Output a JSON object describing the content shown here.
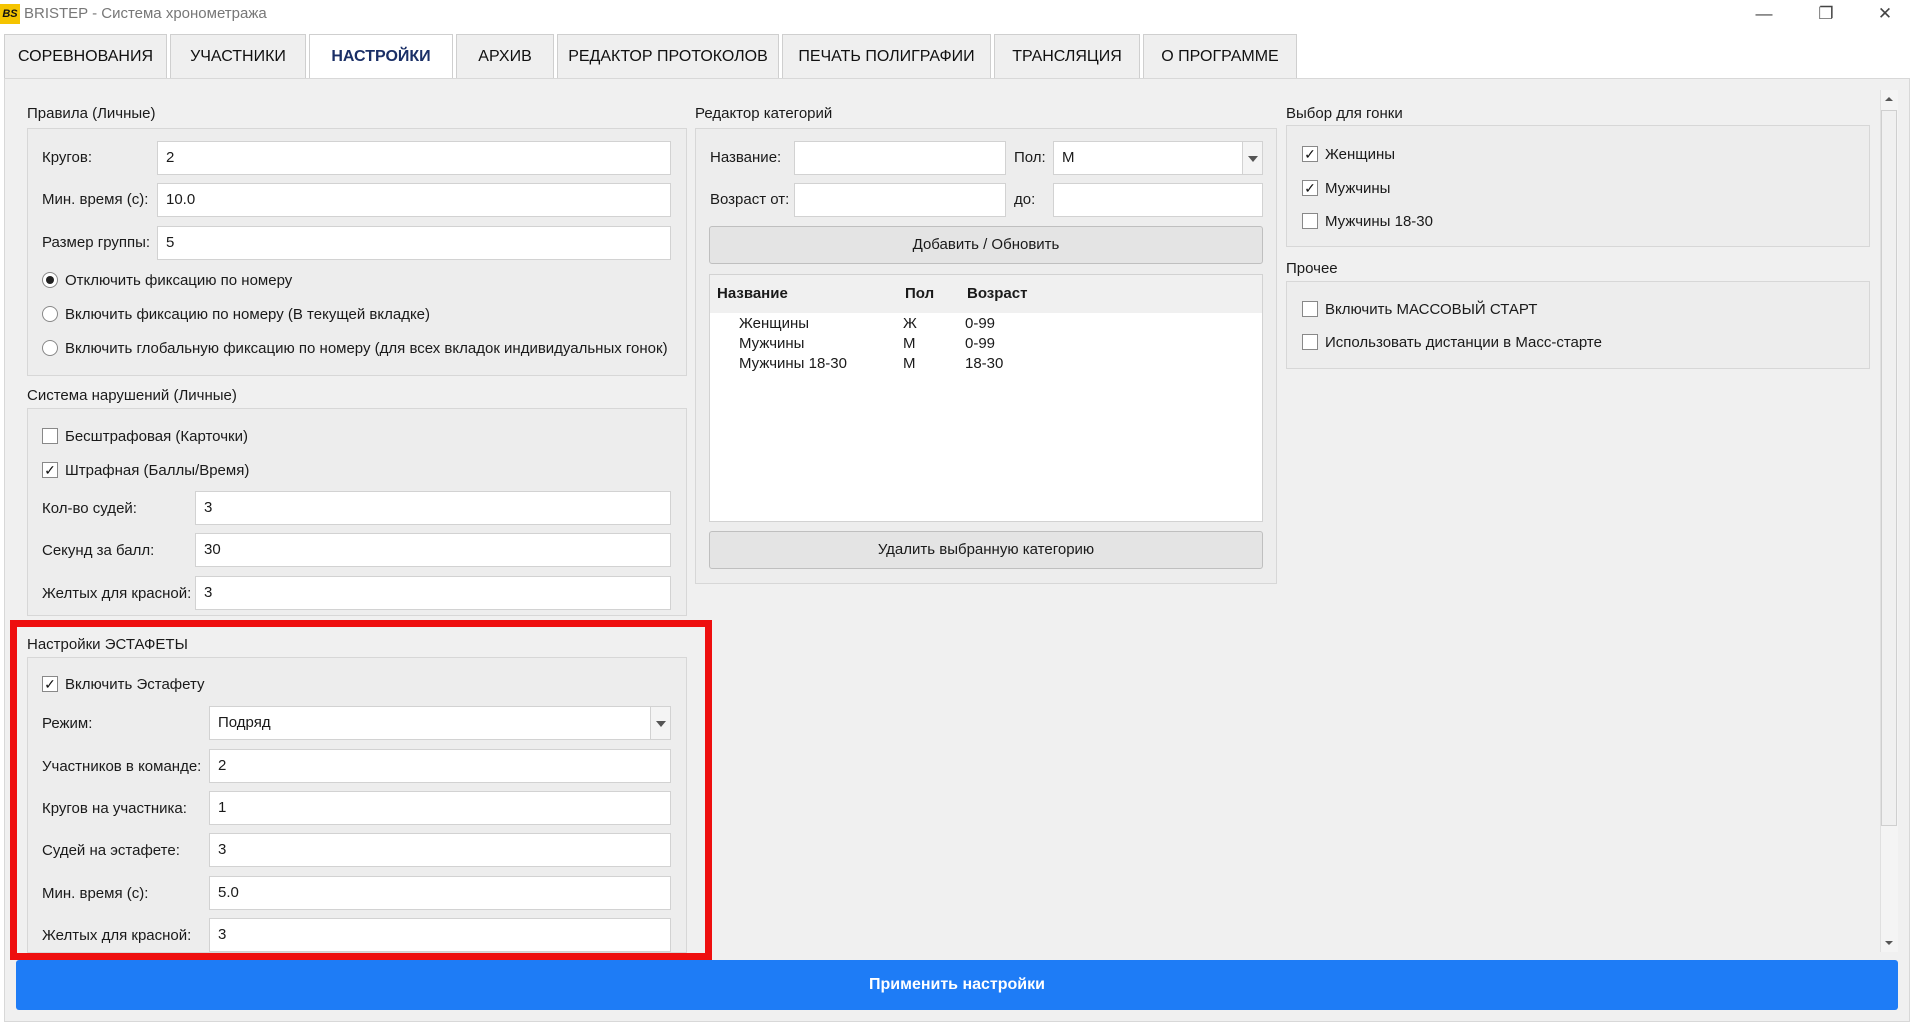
{
  "app": {
    "logo_text": "BS",
    "title": "BRISTEP - Система хронометража",
    "window_controls": {
      "minimize": "—",
      "restore": "❐",
      "close": "✕"
    }
  },
  "tabs": [
    {
      "label": "СОРЕВНОВАНИЯ",
      "active": false
    },
    {
      "label": "УЧАСТНИКИ",
      "active": false
    },
    {
      "label": "НАСТРОЙКИ",
      "active": true
    },
    {
      "label": "АРХИВ",
      "active": false
    },
    {
      "label": "РЕДАКТОР ПРОТОКОЛОВ",
      "active": false
    },
    {
      "label": "ПЕЧАТЬ ПОЛИГРАФИИ",
      "active": false
    },
    {
      "label": "ТРАНСЛЯЦИЯ",
      "active": false
    },
    {
      "label": "О ПРОГРАММЕ",
      "active": false
    }
  ],
  "rules": {
    "title": "Правила (Личные)",
    "laps_label": "Кругов:",
    "laps_value": "2",
    "min_time_label": "Мин. время (с):",
    "min_time_value": "10.0",
    "group_size_label": "Размер группы:",
    "group_size_value": "5",
    "radio_options": [
      {
        "label": "Отключить фиксацию по номеру",
        "selected": true
      },
      {
        "label": "Включить фиксацию по номеру (В текущей вкладке)",
        "selected": false
      },
      {
        "label": "Включить глобальную фиксацию по номеру (для всех вкладок индивидуальных гонок)",
        "selected": false
      }
    ]
  },
  "penalties": {
    "title": "Система нарушений (Личные)",
    "no_penalty_label": "Бесштрафовая (Карточки)",
    "no_penalty_checked": false,
    "penalty_label": "Штрафная (Баллы/Время)",
    "penalty_checked": true,
    "judges_label": "Кол-во судей:",
    "judges_value": "3",
    "seconds_label": "Секунд за балл:",
    "seconds_value": "30",
    "yellows_label": "Желтых для красной:",
    "yellows_value": "3"
  },
  "relay": {
    "title": "Настройки ЭСТАФЕТЫ",
    "enable_label": "Включить Эстафету",
    "enable_checked": true,
    "mode_label": "Режим:",
    "mode_value": "Подряд",
    "members_label": "Участников в команде:",
    "members_value": "2",
    "laps_label": "Кругов на участника:",
    "laps_value": "1",
    "judges_label": "Судей на эстафете:",
    "judges_value": "3",
    "min_time_label": "Мин. время (с):",
    "min_time_value": "5.0",
    "yellows_label": "Желтых для красной:",
    "yellows_value": "3"
  },
  "category_editor": {
    "title": "Редактор категорий",
    "name_label": "Название:",
    "name_value": "",
    "gender_label": "Пол:",
    "gender_value": "М",
    "age_from_label": "Возраст от:",
    "age_from_value": "",
    "age_to_label": "до:",
    "age_to_value": "",
    "add_button": "Добавить / Обновить",
    "columns": [
      "Название",
      "Пол",
      "Возраст"
    ],
    "rows": [
      [
        "Женщины",
        "Ж",
        "0-99"
      ],
      [
        "Мужчины",
        "М",
        "0-99"
      ],
      [
        "Мужчины 18-30",
        "М",
        "18-30"
      ]
    ],
    "delete_button": "Удалить выбранную категорию"
  },
  "race_selection": {
    "title": "Выбор для гонки",
    "items": [
      {
        "label": "Женщины",
        "checked": true
      },
      {
        "label": "Мужчины",
        "checked": true
      },
      {
        "label": "Мужчины 18-30",
        "checked": false
      }
    ]
  },
  "other": {
    "title": "Прочее",
    "items": [
      {
        "label": "Включить МАССОВЫЙ СТАРТ",
        "checked": false
      },
      {
        "label": "Использовать дистанции в Масс-старте",
        "checked": false
      }
    ]
  },
  "apply_button": "Применить настройки",
  "colors": {
    "accent": "#1e7cf6",
    "highlight": "#ee0f0f",
    "active_tab_text": "#1a2f66"
  }
}
